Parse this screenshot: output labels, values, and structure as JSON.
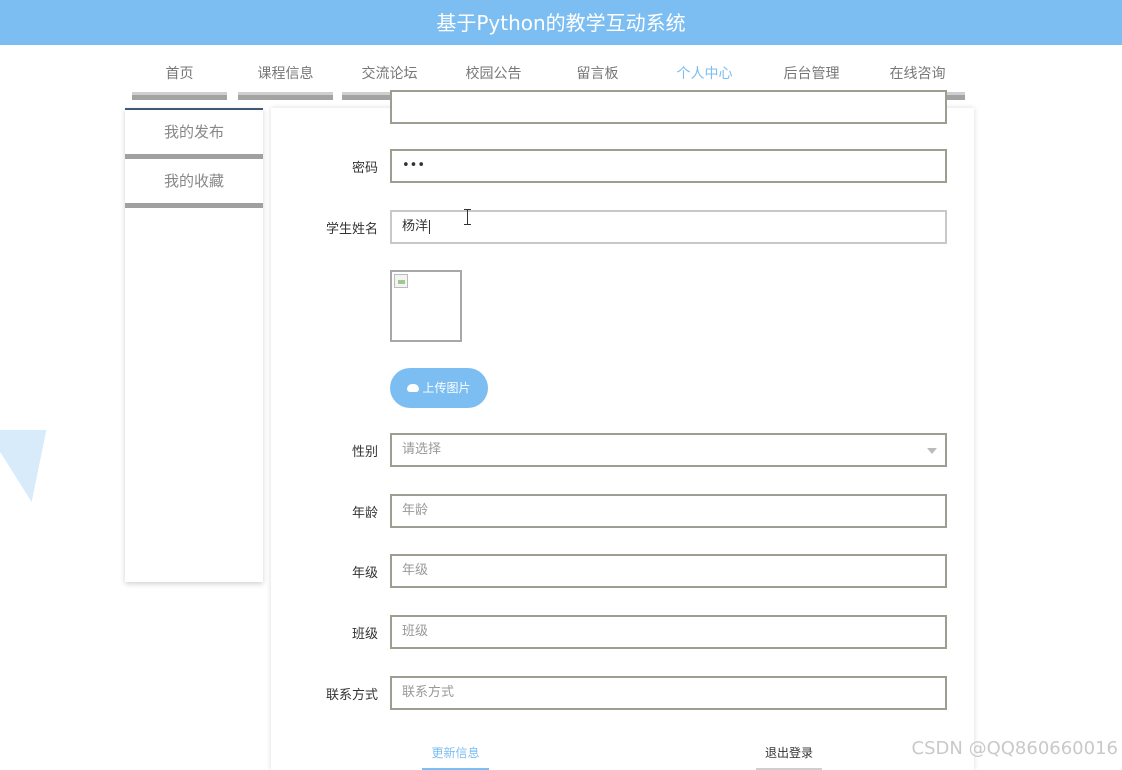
{
  "header": {
    "title": "基于Python的教学互动系统"
  },
  "nav": {
    "items": [
      {
        "label": "首页"
      },
      {
        "label": "课程信息"
      },
      {
        "label": "交流论坛"
      },
      {
        "label": "校园公告"
      },
      {
        "label": "留言板"
      },
      {
        "label": "个人中心",
        "active": true
      },
      {
        "label": "后台管理"
      },
      {
        "label": "在线咨询"
      }
    ]
  },
  "sidebar": {
    "items": [
      {
        "label": "我的发布"
      },
      {
        "label": "我的收藏"
      }
    ]
  },
  "form": {
    "password": {
      "label": "密码",
      "value": "•••"
    },
    "student_name": {
      "label": "学生姓名",
      "value": "杨洋"
    },
    "upload_button": "上传图片",
    "gender": {
      "label": "性别",
      "placeholder": "请选择"
    },
    "age": {
      "label": "年龄",
      "placeholder": "年龄"
    },
    "grade": {
      "label": "年级",
      "placeholder": "年级"
    },
    "class": {
      "label": "班级",
      "placeholder": "班级"
    },
    "contact": {
      "label": "联系方式",
      "placeholder": "联系方式"
    },
    "update_button": "更新信息",
    "logout_button": "退出登录"
  },
  "watermark": "CSDN @QQ860660016",
  "colors": {
    "accent": "#7cbef2",
    "nav_bar": "#a3a3a3",
    "field_border": "#9d9d92"
  }
}
